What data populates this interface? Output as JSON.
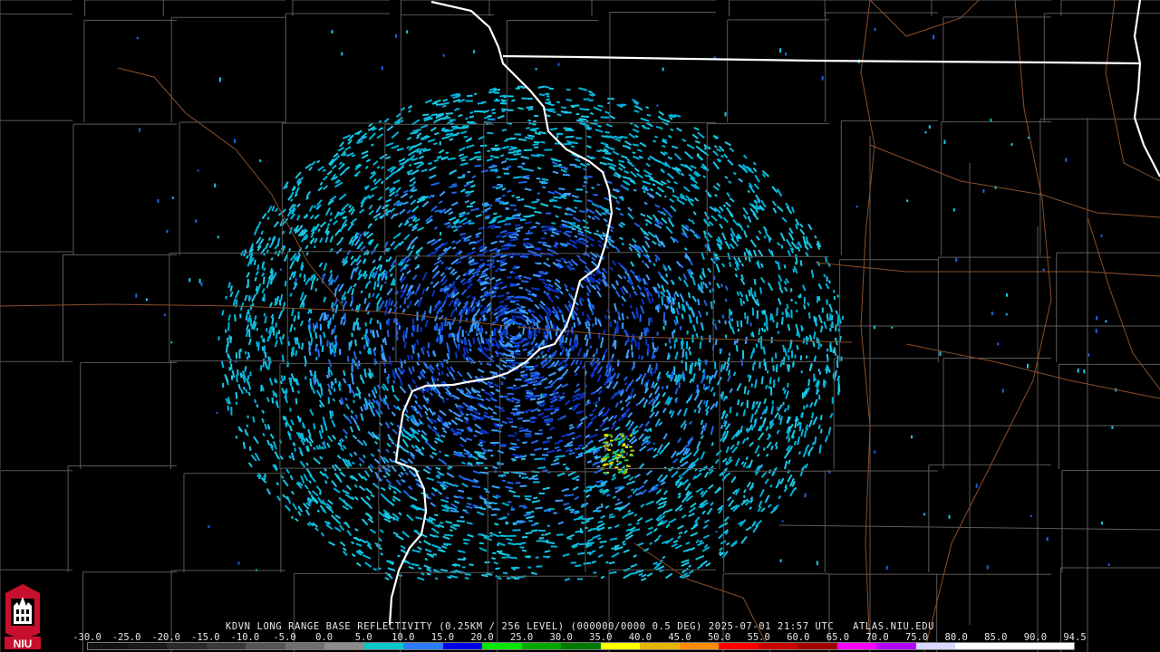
{
  "product_caption": "KDVN LONG RANGE BASE REFLECTIVITY (0.25KM / 256 LEVEL) (000000/0000 0.5 DEG) 2025-07-01 21:57 UTC   ATLAS.NIU.EDU",
  "scale": {
    "labels": [
      "-30.0",
      "-25.0",
      "-20.0",
      "-15.0",
      "-10.0",
      "-5.0",
      "0.0",
      "5.0",
      "10.0",
      "15.0",
      "20.0",
      "25.0",
      "30.0",
      "35.0",
      "40.0",
      "45.0",
      "50.0",
      "55.0",
      "60.0",
      "65.0",
      "70.0",
      "75.0",
      "80.0",
      "85.0",
      "90.0",
      "94.5"
    ],
    "colors": [
      "#111111",
      "#1a1a1a",
      "#2a2a2a",
      "#3a3a3a",
      "#555555",
      "#707070",
      "#8c8c8c",
      "#00c8c8",
      "#2a7cff",
      "#0000e6",
      "#00e600",
      "#00a800",
      "#007a00",
      "#ffff00",
      "#e6b400",
      "#ff8c00",
      "#ff0000",
      "#c80000",
      "#a00000",
      "#ff00ff",
      "#b400ff",
      "#d8d8ff",
      "#ffffff",
      "#ffffff",
      "#ffffff"
    ]
  },
  "radar": {
    "site": "KDVN",
    "echo_colors": [
      "#1ac8e6",
      "#00b4dc",
      "#3aa0ff",
      "#1f64e6",
      "#0a32c8"
    ],
    "core_colors": [
      "#e6e600",
      "#32c832",
      "#c8c800"
    ]
  },
  "map_colors": {
    "county_lines": "#5a5a5a",
    "highways": "#8a4f2a",
    "state_lines": "#ffffff",
    "background": "#000000"
  },
  "logo": {
    "text": "NIU",
    "colors": [
      "#c8102e",
      "#ffffff"
    ]
  }
}
